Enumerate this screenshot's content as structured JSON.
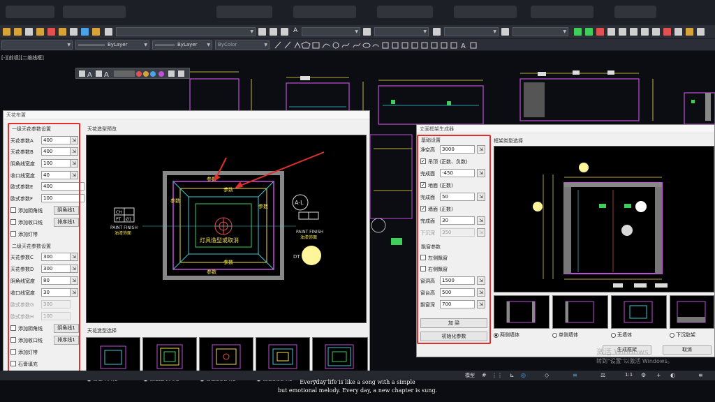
{
  "toolbar": {
    "layer_linetype": "ByLayer",
    "layer_lineweight": "ByLayer",
    "layer_color": "ByColor",
    "text_style_glyph": "A"
  },
  "viewport_label": "[-][前视][二维线框]",
  "ceiling_dialog": {
    "title": "天花布置",
    "level1": {
      "title": "一级天花参数设置",
      "fields": [
        {
          "label": "天花参数A",
          "value": "400"
        },
        {
          "label": "天花参数B",
          "value": "400"
        },
        {
          "label": "阴角线宽度",
          "value": "100"
        },
        {
          "label": "收口线宽度",
          "value": "40"
        },
        {
          "label": "欧式参数E",
          "value": "400"
        },
        {
          "label": "欧式参数F",
          "value": "100"
        }
      ],
      "checks": [
        {
          "label": "添加阴角线",
          "button": "阴角线1"
        },
        {
          "label": "添加收口线",
          "button": "排序线1"
        },
        {
          "label": "添加灯带",
          "button": ""
        }
      ]
    },
    "level2": {
      "title": "二级天花参数设置",
      "fields": [
        {
          "label": "天花参数C",
          "value": "300"
        },
        {
          "label": "天花参数D",
          "value": "300"
        },
        {
          "label": "阴角线宽度",
          "value": "80"
        },
        {
          "label": "收口线宽度",
          "value": "30"
        },
        {
          "label": "欧式参数G",
          "value": "300"
        },
        {
          "label": "欧式参数H",
          "value": "100"
        }
      ],
      "checks": [
        {
          "label": "添加阴角线",
          "button": "阴角线1"
        },
        {
          "label": "添加收口线",
          "button": "排序线1"
        },
        {
          "label": "添加灯带",
          "button": ""
        },
        {
          "label": "石膏填充",
          "button": ""
        }
      ]
    },
    "preview_title": "天花造型预览",
    "preview_labels": {
      "param1": "参数",
      "param2": "参数",
      "center": "灯具造型或取消",
      "al": "A-L",
      "dt": "DT",
      "paint": "PAINT FINISH",
      "paint_cn": "油漆饰面",
      "ch": "CH",
      "pt": "PT",
      "d1": "Ø1"
    },
    "shape_title": "天花造型选择",
    "shapes": [
      "普通平天花",
      "普通边吊天花",
      "普通欧式天花",
      "普通欧式天花2",
      "双边吊天花"
    ]
  },
  "frame_dialog": {
    "title": "立面框架生成器",
    "params_title": "基础设置",
    "fields": [
      {
        "label": "净空高",
        "value": "3000",
        "check": false
      },
      {
        "label": "吊顶 (正数、负数)",
        "value": "",
        "check": true
      },
      {
        "label": "完成面",
        "value": "-450",
        "check": false
      },
      {
        "label": "地面 (正数)",
        "value": "",
        "check": true
      },
      {
        "label": "完成面",
        "value": "50",
        "check": false
      },
      {
        "label": "墙面 (正数)",
        "value": "",
        "check": true
      },
      {
        "label": "完成面",
        "value": "30",
        "check": false
      },
      {
        "label": "下沉深",
        "value": "350",
        "check": false
      }
    ],
    "window_title": "飘窗参数",
    "window_checks": [
      "左侧飘窗",
      "右侧飘窗"
    ],
    "window_fields": [
      {
        "label": "窗洞高",
        "value": "1500"
      },
      {
        "label": "窗台高",
        "value": "500"
      },
      {
        "label": "飘窗深",
        "value": "700"
      }
    ],
    "btn_add": "加 梁",
    "btn_init": "初始化参数",
    "type_title": "框架类型选择",
    "radios": [
      {
        "label": "两侧墙体",
        "on": true
      },
      {
        "label": "单侧墙体",
        "on": false
      },
      {
        "label": "无墙体",
        "on": false
      },
      {
        "label": "下沉駐架",
        "on": false
      }
    ],
    "btn_generate": "生成框架",
    "btn_cancel": "取消"
  },
  "activate_windows": {
    "line1": "激活 Windows",
    "line2": "转到\"设置\"以激活 Windows。"
  },
  "subtitles": {
    "line1": "Everyday life is like a song with a simple",
    "line2": "but emotional melody. Every day, a new chapter is sung."
  },
  "status": {
    "model": "模型",
    "scale": "1:1"
  },
  "colors": {
    "accent_red": "#e0302e",
    "cad_yellow": "#f5e14a",
    "cad_magenta": "#c050d8",
    "cad_cyan": "#3cc9d8",
    "cad_green": "#3ecf5a"
  }
}
